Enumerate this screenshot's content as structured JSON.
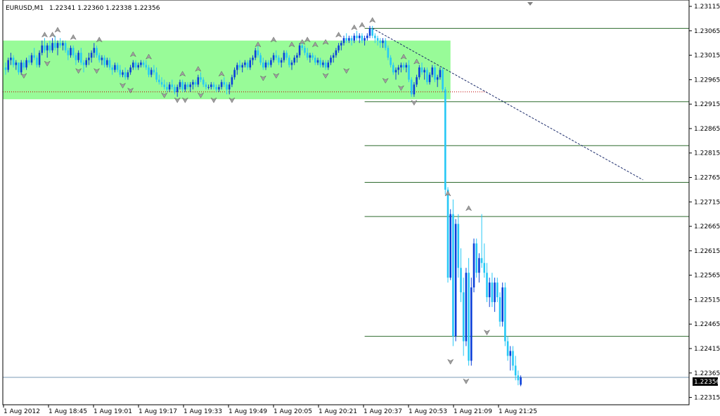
{
  "header": {
    "symbol": "EURUSD,M1",
    "ohlc": "1.22341 1.22360 1.22338 1.22356"
  },
  "colors": {
    "bull": "#0a3fd9",
    "bear": "#27c8f5",
    "zone": "#98fb98",
    "level": "#2e6b2e",
    "price_line": "#7a9bb5",
    "dotted": "#c00000",
    "trend": "#1a2a6a",
    "fractal": "#a0a0a0"
  },
  "chart_data": {
    "type": "candlestick",
    "symbol": "EURUSD",
    "timeframe": "M1",
    "ylim": [
      1.223,
      1.23128
    ],
    "y_ticks": [
      "1.23115",
      "1.23065",
      "1.23015",
      "1.22965",
      "1.22915",
      "1.22865",
      "1.22815",
      "1.22765",
      "1.22715",
      "1.22665",
      "1.22615",
      "1.22565",
      "1.22515",
      "1.22465",
      "1.22415",
      "1.22365",
      "1.22315"
    ],
    "x_ticks": [
      "1 Aug 2012",
      "1 Aug 18:45",
      "1 Aug 19:01",
      "1 Aug 19:17",
      "1 Aug 19:33",
      "1 Aug 19:49",
      "1 Aug 20:05",
      "1 Aug 20:21",
      "1 Aug 20:37",
      "1 Aug 20:53",
      "1 Aug 21:09",
      "1 Aug 21:25"
    ],
    "current_price": "1.22356",
    "zone": {
      "top": 1.23045,
      "bottom": 1.22925,
      "from_bar": 0,
      "to_bar": 171
    },
    "dotted_level": 1.2294,
    "levels": [
      1.2307,
      1.2292,
      1.2283,
      1.22755,
      1.22685,
      1.2244
    ],
    "trendline": {
      "from_bar": 141,
      "from_price": 1.2307,
      "to_bar": 245,
      "to_price": 1.2276
    },
    "candles": [
      [
        1.2299,
        1.23,
        1.22975,
        1.22985
      ],
      [
        1.22985,
        1.2301,
        1.2298,
        1.23005
      ],
      [
        1.23005,
        1.2302,
        1.22995,
        1.2301
      ],
      [
        1.2301,
        1.23015,
        1.2299,
        1.22995
      ],
      [
        1.22995,
        1.23005,
        1.22985,
        1.23
      ],
      [
        1.23,
        1.23,
        1.22975,
        1.2298
      ],
      [
        1.2298,
        1.23005,
        1.22975,
        1.23
      ],
      [
        1.23,
        1.23005,
        1.22985,
        1.2299
      ],
      [
        1.2299,
        1.2301,
        1.22985,
        1.23005
      ],
      [
        1.23005,
        1.23015,
        1.22995,
        1.23
      ],
      [
        1.23,
        1.2302,
        1.22995,
        1.23015
      ],
      [
        1.23015,
        1.2303,
        1.23005,
        1.2301
      ],
      [
        1.2301,
        1.23015,
        1.2299,
        1.22995
      ],
      [
        1.22995,
        1.23025,
        1.2299,
        1.2302
      ],
      [
        1.2302,
        1.23045,
        1.23015,
        1.23035
      ],
      [
        1.23035,
        1.2305,
        1.2302,
        1.23025
      ],
      [
        1.23025,
        1.2304,
        1.2301,
        1.23035
      ],
      [
        1.23035,
        1.23045,
        1.2302,
        1.23025
      ],
      [
        1.23025,
        1.2305,
        1.2302,
        1.2304
      ],
      [
        1.2304,
        1.23055,
        1.23025,
        1.2303
      ],
      [
        1.2303,
        1.23045,
        1.23015,
        1.2304
      ],
      [
        1.2304,
        1.2305,
        1.2303,
        1.23035
      ],
      [
        1.23035,
        1.23045,
        1.23025,
        1.2304
      ],
      [
        1.2304,
        1.23045,
        1.2302,
        1.23025
      ],
      [
        1.23025,
        1.2303,
        1.23005,
        1.23015
      ],
      [
        1.23015,
        1.23035,
        1.2301,
        1.2303
      ],
      [
        1.2303,
        1.23035,
        1.2301,
        1.23015
      ],
      [
        1.23015,
        1.2302,
        1.22995,
        1.23005
      ],
      [
        1.23005,
        1.23025,
        1.23,
        1.2302
      ],
      [
        1.2302,
        1.2303,
        1.22995,
        1.23
      ],
      [
        1.23,
        1.23005,
        1.2298,
        1.22995
      ],
      [
        1.22995,
        1.2301,
        1.2299,
        1.23005
      ],
      [
        1.23005,
        1.2302,
        1.22995,
        1.2301
      ],
      [
        1.2301,
        1.23025,
        1.23,
        1.2302
      ],
      [
        1.2302,
        1.2304,
        1.2301,
        1.2303
      ],
      [
        1.2303,
        1.23035,
        1.2301,
        1.23015
      ],
      [
        1.23015,
        1.2302,
        1.23,
        1.23005
      ],
      [
        1.23005,
        1.23015,
        1.22995,
        1.2301
      ],
      [
        1.2301,
        1.23015,
        1.2299,
        1.22995
      ],
      [
        1.22995,
        1.2301,
        1.2299,
        1.23005
      ],
      [
        1.23005,
        1.2301,
        1.22985,
        1.2299
      ],
      [
        1.2299,
        1.22995,
        1.22975,
        1.22985
      ],
      [
        1.22985,
        1.23,
        1.2298,
        1.22995
      ],
      [
        1.22995,
        1.23,
        1.2298,
        1.22985
      ],
      [
        1.22985,
        1.22995,
        1.2297,
        1.22975
      ],
      [
        1.22975,
        1.22985,
        1.2297,
        1.2298
      ],
      [
        1.2298,
        1.2299,
        1.22965,
        1.2297
      ],
      [
        1.2297,
        1.22985,
        1.22965,
        1.2298
      ],
      [
        1.2298,
        1.22995,
        1.22975,
        1.2299
      ],
      [
        1.2299,
        1.23005,
        1.22985,
        1.23
      ],
      [
        1.23,
        1.23005,
        1.22985,
        1.2299
      ],
      [
        1.2299,
        1.23,
        1.22985,
        1.22995
      ],
      [
        1.22995,
        1.23005,
        1.2299,
        1.23
      ],
      [
        1.23,
        1.23005,
        1.2299,
        1.22995
      ],
      [
        1.22995,
        1.23005,
        1.22985,
        1.2299
      ],
      [
        1.2299,
        1.22995,
        1.2297,
        1.22975
      ],
      [
        1.22975,
        1.2299,
        1.2297,
        1.22985
      ],
      [
        1.22985,
        1.22995,
        1.22975,
        1.2298
      ],
      [
        1.2298,
        1.2299,
        1.2296,
        1.22965
      ],
      [
        1.22965,
        1.22975,
        1.22955,
        1.2296
      ],
      [
        1.2296,
        1.2297,
        1.2295,
        1.22955
      ],
      [
        1.22955,
        1.22965,
        1.22945,
        1.2295
      ],
      [
        1.2295,
        1.2296,
        1.2294,
        1.22945
      ],
      [
        1.22945,
        1.2296,
        1.2294,
        1.22955
      ],
      [
        1.22955,
        1.22965,
        1.22945,
        1.2295
      ],
      [
        1.2295,
        1.22955,
        1.22935,
        1.2294
      ],
      [
        1.2294,
        1.22955,
        1.2293,
        1.2295
      ],
      [
        1.2295,
        1.22965,
        1.22945,
        1.2296
      ],
      [
        1.2296,
        1.22965,
        1.2294,
        1.22945
      ],
      [
        1.22945,
        1.2296,
        1.2294,
        1.22955
      ],
      [
        1.22955,
        1.2296,
        1.22945,
        1.2295
      ],
      [
        1.2295,
        1.2296,
        1.2294,
        1.22955
      ],
      [
        1.22955,
        1.22965,
        1.22945,
        1.2296
      ],
      [
        1.2296,
        1.22965,
        1.2295,
        1.22955
      ],
      [
        1.22955,
        1.22975,
        1.2295,
        1.2297
      ],
      [
        1.2297,
        1.2298,
        1.2296,
        1.22965
      ],
      [
        1.22965,
        1.2297,
        1.2295,
        1.22955
      ],
      [
        1.22955,
        1.2296,
        1.22945,
        1.2295
      ],
      [
        1.2295,
        1.22955,
        1.22945,
        1.2295
      ],
      [
        1.2295,
        1.2296,
        1.22945,
        1.22955
      ],
      [
        1.22955,
        1.2296,
        1.22945,
        1.2295
      ],
      [
        1.2295,
        1.22955,
        1.2294,
        1.22945
      ],
      [
        1.22945,
        1.22955,
        1.2294,
        1.2295
      ],
      [
        1.2295,
        1.22965,
        1.22945,
        1.2296
      ],
      [
        1.2296,
        1.2297,
        1.2295,
        1.22955
      ],
      [
        1.22955,
        1.2296,
        1.22935,
        1.22945
      ],
      [
        1.22945,
        1.2296,
        1.22935,
        1.22955
      ],
      [
        1.22955,
        1.22975,
        1.2295,
        1.2297
      ],
      [
        1.2297,
        1.2299,
        1.22965,
        1.22985
      ],
      [
        1.22985,
        1.23,
        1.22975,
        1.22995
      ],
      [
        1.22995,
        1.23005,
        1.22985,
        1.2299
      ],
      [
        1.2299,
        1.23,
        1.2298,
        1.22995
      ],
      [
        1.22995,
        1.23005,
        1.2299,
        1.23
      ],
      [
        1.23,
        1.23005,
        1.22985,
        1.2299
      ],
      [
        1.2299,
        1.2301,
        1.22985,
        1.23005
      ],
      [
        1.23005,
        1.23015,
        1.22995,
        1.2301
      ],
      [
        1.2301,
        1.2303,
        1.23005,
        1.23025
      ],
      [
        1.23025,
        1.23035,
        1.2301,
        1.23015
      ],
      [
        1.23015,
        1.2302,
        1.22995,
        1.23
      ],
      [
        1.23,
        1.2301,
        1.22985,
        1.2299
      ],
      [
        1.2299,
        1.23005,
        1.22985,
        1.23
      ],
      [
        1.23,
        1.23005,
        1.2299,
        1.22995
      ],
      [
        1.22995,
        1.2301,
        1.2299,
        1.23005
      ],
      [
        1.23005,
        1.2302,
        1.23,
        1.23015
      ],
      [
        1.23015,
        1.23025,
        1.23005,
        1.2301
      ],
      [
        1.2301,
        1.23015,
        1.22995,
        1.23
      ],
      [
        1.23,
        1.2301,
        1.2299,
        1.23005
      ],
      [
        1.23005,
        1.23025,
        1.23,
        1.2302
      ],
      [
        1.2302,
        1.23025,
        1.23005,
        1.2301
      ],
      [
        1.2301,
        1.23015,
        1.2299,
        1.22995
      ],
      [
        1.22995,
        1.23005,
        1.22985,
        1.23
      ],
      [
        1.23,
        1.23015,
        1.22995,
        1.2301
      ],
      [
        1.2301,
        1.2302,
        1.23,
        1.23015
      ],
      [
        1.23015,
        1.2304,
        1.2301,
        1.23035
      ],
      [
        1.23035,
        1.23045,
        1.23025,
        1.2303
      ],
      [
        1.2303,
        1.23035,
        1.23015,
        1.2302
      ],
      [
        1.2302,
        1.2303,
        1.23005,
        1.2301
      ],
      [
        1.2301,
        1.2302,
        1.23,
        1.23015
      ],
      [
        1.23015,
        1.2302,
        1.23005,
        1.2301
      ],
      [
        1.2301,
        1.23015,
        1.22995,
        1.23
      ],
      [
        1.23,
        1.2301,
        1.22995,
        1.23005
      ],
      [
        1.23005,
        1.2301,
        1.2299,
        1.22995
      ],
      [
        1.22995,
        1.23005,
        1.2299,
        1.23
      ],
      [
        1.23,
        1.23005,
        1.22985,
        1.2299
      ],
      [
        1.2299,
        1.23005,
        1.22985,
        1.23
      ],
      [
        1.23,
        1.23015,
        1.22995,
        1.2301
      ],
      [
        1.2301,
        1.2302,
        1.23,
        1.23015
      ],
      [
        1.23015,
        1.2303,
        1.2301,
        1.23025
      ],
      [
        1.23025,
        1.2304,
        1.2302,
        1.23035
      ],
      [
        1.23035,
        1.23045,
        1.23025,
        1.2304
      ],
      [
        1.2304,
        1.23055,
        1.23035,
        1.2305
      ],
      [
        1.2305,
        1.2306,
        1.2304,
        1.23045
      ],
      [
        1.23045,
        1.23055,
        1.2304,
        1.2305
      ],
      [
        1.2305,
        1.23055,
        1.23035,
        1.23045
      ],
      [
        1.23045,
        1.2306,
        1.2304,
        1.23055
      ],
      [
        1.23055,
        1.23065,
        1.23045,
        1.2305
      ],
      [
        1.2305,
        1.2306,
        1.2304,
        1.23055
      ],
      [
        1.23055,
        1.2306,
        1.2304,
        1.23045
      ],
      [
        1.23045,
        1.23055,
        1.23035,
        1.2305
      ],
      [
        1.2305,
        1.2306,
        1.23045,
        1.23055
      ],
      [
        1.23055,
        1.23075,
        1.2305,
        1.2307
      ],
      [
        1.2307,
        1.23075,
        1.2305,
        1.23055
      ],
      [
        1.23055,
        1.2306,
        1.2304,
        1.2305
      ],
      [
        1.2305,
        1.23055,
        1.23035,
        1.23045
      ],
      [
        1.23045,
        1.2305,
        1.2303,
        1.2304
      ],
      [
        1.2304,
        1.2305,
        1.2303,
        1.23045
      ],
      [
        1.23045,
        1.2305,
        1.23025,
        1.2303
      ],
      [
        1.2303,
        1.23035,
        1.23005,
        1.2301
      ],
      [
        1.2301,
        1.23015,
        1.2299,
        1.22995
      ],
      [
        1.22995,
        1.23,
        1.22975,
        1.2298
      ],
      [
        1.2298,
        1.2299,
        1.22965,
        1.22985
      ],
      [
        1.22985,
        1.22995,
        1.22975,
        1.2299
      ],
      [
        1.2299,
        1.23,
        1.2298,
        1.22995
      ],
      [
        1.22995,
        1.23,
        1.22985,
        1.2299
      ],
      [
        1.2299,
        1.23,
        1.2298,
        1.22995
      ],
      [
        1.22995,
        1.23005,
        1.2296,
        1.22965
      ],
      [
        1.22965,
        1.2297,
        1.2293,
        1.22935
      ],
      [
        1.22935,
        1.2296,
        1.2293,
        1.22955
      ],
      [
        1.22955,
        1.22975,
        1.2295,
        1.2297
      ],
      [
        1.2297,
        1.22995,
        1.22965,
        1.2299
      ],
      [
        1.2299,
        1.23,
        1.22975,
        1.2298
      ],
      [
        1.2298,
        1.2299,
        1.22965,
        1.22985
      ],
      [
        1.22985,
        1.2299,
        1.22955,
        1.2296
      ],
      [
        1.2296,
        1.2298,
        1.22955,
        1.22975
      ],
      [
        1.22975,
        1.22995,
        1.2297,
        1.2299
      ],
      [
        1.2299,
        1.22995,
        1.2296,
        1.22965
      ],
      [
        1.22965,
        1.22975,
        1.2295,
        1.2297
      ],
      [
        1.2297,
        1.2299,
        1.22965,
        1.22985
      ],
      [
        1.22985,
        1.2299,
        1.2294,
        1.22945
      ],
      [
        1.22945,
        1.2295,
        1.2273,
        1.2274
      ],
      [
        1.2274,
        1.22745,
        1.2255,
        1.2256
      ],
      [
        1.2256,
        1.227,
        1.22555,
        1.2269
      ],
      [
        1.2269,
        1.2272,
        1.2242,
        1.2244
      ],
      [
        1.2244,
        1.2268,
        1.2243,
        1.2267
      ],
      [
        1.2267,
        1.2269,
        1.2256,
        1.2258
      ],
      [
        1.2258,
        1.2262,
        1.2251,
        1.2253
      ],
      [
        1.2253,
        1.2256,
        1.224,
        1.2243
      ],
      [
        1.2243,
        1.2258,
        1.2242,
        1.2257
      ],
      [
        1.2257,
        1.226,
        1.2238,
        1.2239
      ],
      [
        1.2239,
        1.2256,
        1.2238,
        1.2254
      ],
      [
        1.2254,
        1.2264,
        1.2253,
        1.2263
      ],
      [
        1.2263,
        1.2264,
        1.2256,
        1.2257
      ],
      [
        1.2257,
        1.2261,
        1.2255,
        1.226
      ],
      [
        1.226,
        1.2269,
        1.2258,
        1.2259
      ],
      [
        1.2259,
        1.2263,
        1.2256,
        1.2257
      ],
      [
        1.2257,
        1.2259,
        1.2251,
        1.2252
      ],
      [
        1.2252,
        1.2256,
        1.225,
        1.2255
      ],
      [
        1.2255,
        1.2257,
        1.225,
        1.2251
      ],
      [
        1.2251,
        1.2256,
        1.2249,
        1.2255
      ],
      [
        1.2255,
        1.2256,
        1.2251,
        1.2252
      ],
      [
        1.2252,
        1.2253,
        1.2246,
        1.2247
      ],
      [
        1.2247,
        1.2255,
        1.2246,
        1.2254
      ],
      [
        1.2254,
        1.2255,
        1.2242,
        1.2243
      ],
      [
        1.2243,
        1.2244,
        1.2239,
        1.224
      ],
      [
        1.224,
        1.2242,
        1.2237,
        1.2241
      ],
      [
        1.2241,
        1.2242,
        1.2237,
        1.2238
      ],
      [
        1.2238,
        1.224,
        1.2235,
        1.2236
      ],
      [
        1.2236,
        1.2237,
        1.2234,
        1.2235
      ],
      [
        1.22341,
        1.2236,
        1.22338,
        1.22356
      ]
    ],
    "ups": [
      [
        15,
        1.23045
      ],
      [
        18,
        1.23045
      ],
      [
        20,
        1.23055
      ],
      [
        26,
        1.2304
      ],
      [
        36,
        1.23035
      ],
      [
        49,
        1.23005
      ],
      [
        55,
        1.23
      ],
      [
        68,
        1.22965
      ],
      [
        74,
        1.22975
      ],
      [
        83,
        1.22965
      ],
      [
        97,
        1.23025
      ],
      [
        103,
        1.23035
      ],
      [
        110,
        1.23025
      ],
      [
        114,
        1.2303
      ],
      [
        116,
        1.23035
      ],
      [
        119,
        1.23025
      ],
      [
        123,
        1.2303
      ],
      [
        128,
        1.23045
      ],
      [
        134,
        1.2306
      ],
      [
        137,
        1.23065
      ],
      [
        141,
        1.23075
      ],
      [
        153,
        1.23
      ],
      [
        158,
        1.2299
      ],
      [
        170,
        1.2272
      ],
      [
        178,
        1.2269
      ]
    ],
    "downs": [
      [
        7,
        1.22985
      ],
      [
        16,
        1.2301
      ],
      [
        28,
        1.22995
      ],
      [
        35,
        1.22995
      ],
      [
        45,
        1.22965
      ],
      [
        48,
        1.22955
      ],
      [
        61,
        1.22945
      ],
      [
        66,
        1.22935
      ],
      [
        69,
        1.22935
      ],
      [
        75,
        1.22945
      ],
      [
        80,
        1.22935
      ],
      [
        87,
        1.22935
      ],
      [
        99,
        1.2298
      ],
      [
        104,
        1.22985
      ],
      [
        123,
        1.22985
      ],
      [
        131,
        1.22995
      ],
      [
        146,
        1.22975
      ],
      [
        152,
        1.2296
      ],
      [
        157,
        1.2293
      ],
      [
        171,
        1.224
      ],
      [
        177,
        1.2236
      ],
      [
        185,
        1.2246
      ]
    ]
  }
}
